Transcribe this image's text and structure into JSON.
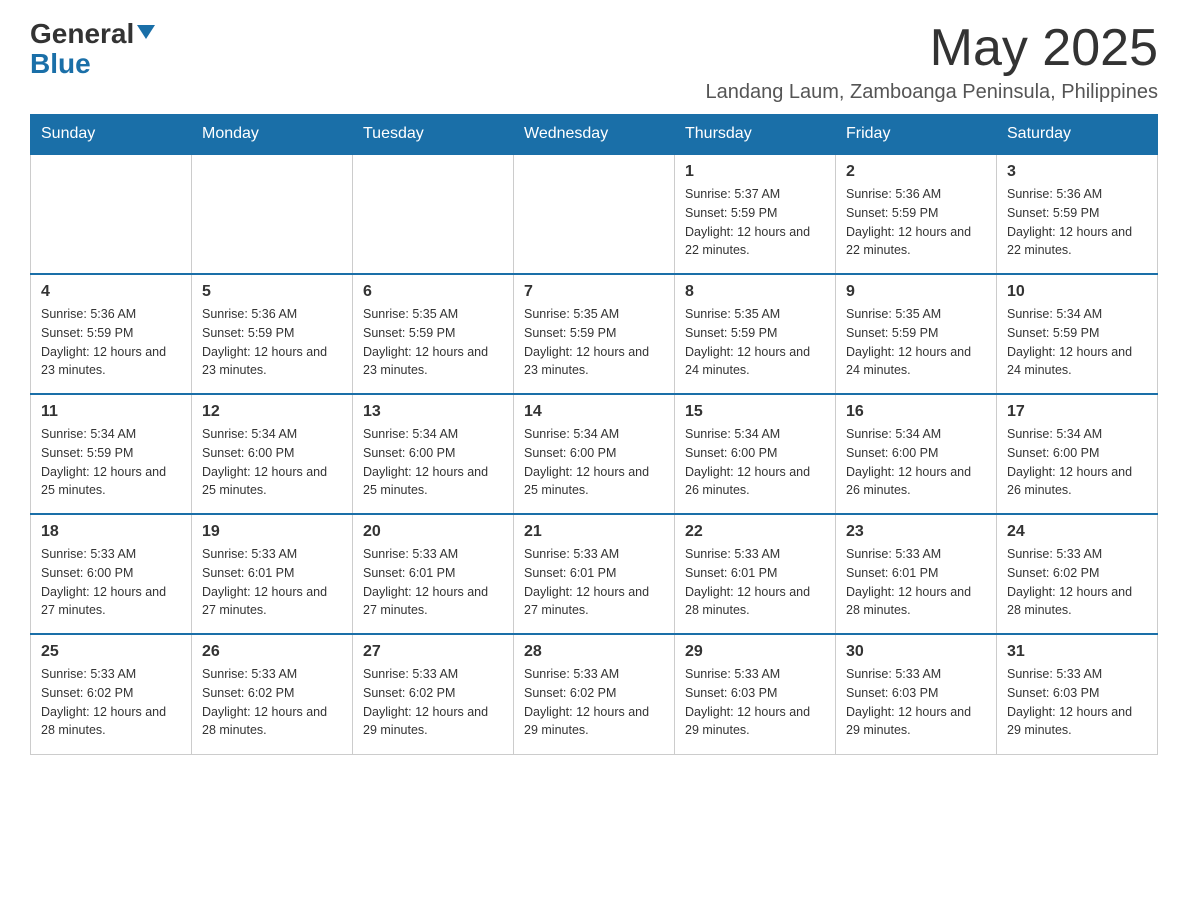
{
  "logo": {
    "general": "General",
    "blue": "Blue"
  },
  "header": {
    "month": "May 2025",
    "location": "Landang Laum, Zamboanga Peninsula, Philippines"
  },
  "weekdays": [
    "Sunday",
    "Monday",
    "Tuesday",
    "Wednesday",
    "Thursday",
    "Friday",
    "Saturday"
  ],
  "weeks": [
    [
      {
        "day": "",
        "info": ""
      },
      {
        "day": "",
        "info": ""
      },
      {
        "day": "",
        "info": ""
      },
      {
        "day": "",
        "info": ""
      },
      {
        "day": "1",
        "info": "Sunrise: 5:37 AM\nSunset: 5:59 PM\nDaylight: 12 hours and 22 minutes."
      },
      {
        "day": "2",
        "info": "Sunrise: 5:36 AM\nSunset: 5:59 PM\nDaylight: 12 hours and 22 minutes."
      },
      {
        "day": "3",
        "info": "Sunrise: 5:36 AM\nSunset: 5:59 PM\nDaylight: 12 hours and 22 minutes."
      }
    ],
    [
      {
        "day": "4",
        "info": "Sunrise: 5:36 AM\nSunset: 5:59 PM\nDaylight: 12 hours and 23 minutes."
      },
      {
        "day": "5",
        "info": "Sunrise: 5:36 AM\nSunset: 5:59 PM\nDaylight: 12 hours and 23 minutes."
      },
      {
        "day": "6",
        "info": "Sunrise: 5:35 AM\nSunset: 5:59 PM\nDaylight: 12 hours and 23 minutes."
      },
      {
        "day": "7",
        "info": "Sunrise: 5:35 AM\nSunset: 5:59 PM\nDaylight: 12 hours and 23 minutes."
      },
      {
        "day": "8",
        "info": "Sunrise: 5:35 AM\nSunset: 5:59 PM\nDaylight: 12 hours and 24 minutes."
      },
      {
        "day": "9",
        "info": "Sunrise: 5:35 AM\nSunset: 5:59 PM\nDaylight: 12 hours and 24 minutes."
      },
      {
        "day": "10",
        "info": "Sunrise: 5:34 AM\nSunset: 5:59 PM\nDaylight: 12 hours and 24 minutes."
      }
    ],
    [
      {
        "day": "11",
        "info": "Sunrise: 5:34 AM\nSunset: 5:59 PM\nDaylight: 12 hours and 25 minutes."
      },
      {
        "day": "12",
        "info": "Sunrise: 5:34 AM\nSunset: 6:00 PM\nDaylight: 12 hours and 25 minutes."
      },
      {
        "day": "13",
        "info": "Sunrise: 5:34 AM\nSunset: 6:00 PM\nDaylight: 12 hours and 25 minutes."
      },
      {
        "day": "14",
        "info": "Sunrise: 5:34 AM\nSunset: 6:00 PM\nDaylight: 12 hours and 25 minutes."
      },
      {
        "day": "15",
        "info": "Sunrise: 5:34 AM\nSunset: 6:00 PM\nDaylight: 12 hours and 26 minutes."
      },
      {
        "day": "16",
        "info": "Sunrise: 5:34 AM\nSunset: 6:00 PM\nDaylight: 12 hours and 26 minutes."
      },
      {
        "day": "17",
        "info": "Sunrise: 5:34 AM\nSunset: 6:00 PM\nDaylight: 12 hours and 26 minutes."
      }
    ],
    [
      {
        "day": "18",
        "info": "Sunrise: 5:33 AM\nSunset: 6:00 PM\nDaylight: 12 hours and 27 minutes."
      },
      {
        "day": "19",
        "info": "Sunrise: 5:33 AM\nSunset: 6:01 PM\nDaylight: 12 hours and 27 minutes."
      },
      {
        "day": "20",
        "info": "Sunrise: 5:33 AM\nSunset: 6:01 PM\nDaylight: 12 hours and 27 minutes."
      },
      {
        "day": "21",
        "info": "Sunrise: 5:33 AM\nSunset: 6:01 PM\nDaylight: 12 hours and 27 minutes."
      },
      {
        "day": "22",
        "info": "Sunrise: 5:33 AM\nSunset: 6:01 PM\nDaylight: 12 hours and 28 minutes."
      },
      {
        "day": "23",
        "info": "Sunrise: 5:33 AM\nSunset: 6:01 PM\nDaylight: 12 hours and 28 minutes."
      },
      {
        "day": "24",
        "info": "Sunrise: 5:33 AM\nSunset: 6:02 PM\nDaylight: 12 hours and 28 minutes."
      }
    ],
    [
      {
        "day": "25",
        "info": "Sunrise: 5:33 AM\nSunset: 6:02 PM\nDaylight: 12 hours and 28 minutes."
      },
      {
        "day": "26",
        "info": "Sunrise: 5:33 AM\nSunset: 6:02 PM\nDaylight: 12 hours and 28 minutes."
      },
      {
        "day": "27",
        "info": "Sunrise: 5:33 AM\nSunset: 6:02 PM\nDaylight: 12 hours and 29 minutes."
      },
      {
        "day": "28",
        "info": "Sunrise: 5:33 AM\nSunset: 6:02 PM\nDaylight: 12 hours and 29 minutes."
      },
      {
        "day": "29",
        "info": "Sunrise: 5:33 AM\nSunset: 6:03 PM\nDaylight: 12 hours and 29 minutes."
      },
      {
        "day": "30",
        "info": "Sunrise: 5:33 AM\nSunset: 6:03 PM\nDaylight: 12 hours and 29 minutes."
      },
      {
        "day": "31",
        "info": "Sunrise: 5:33 AM\nSunset: 6:03 PM\nDaylight: 12 hours and 29 minutes."
      }
    ]
  ]
}
